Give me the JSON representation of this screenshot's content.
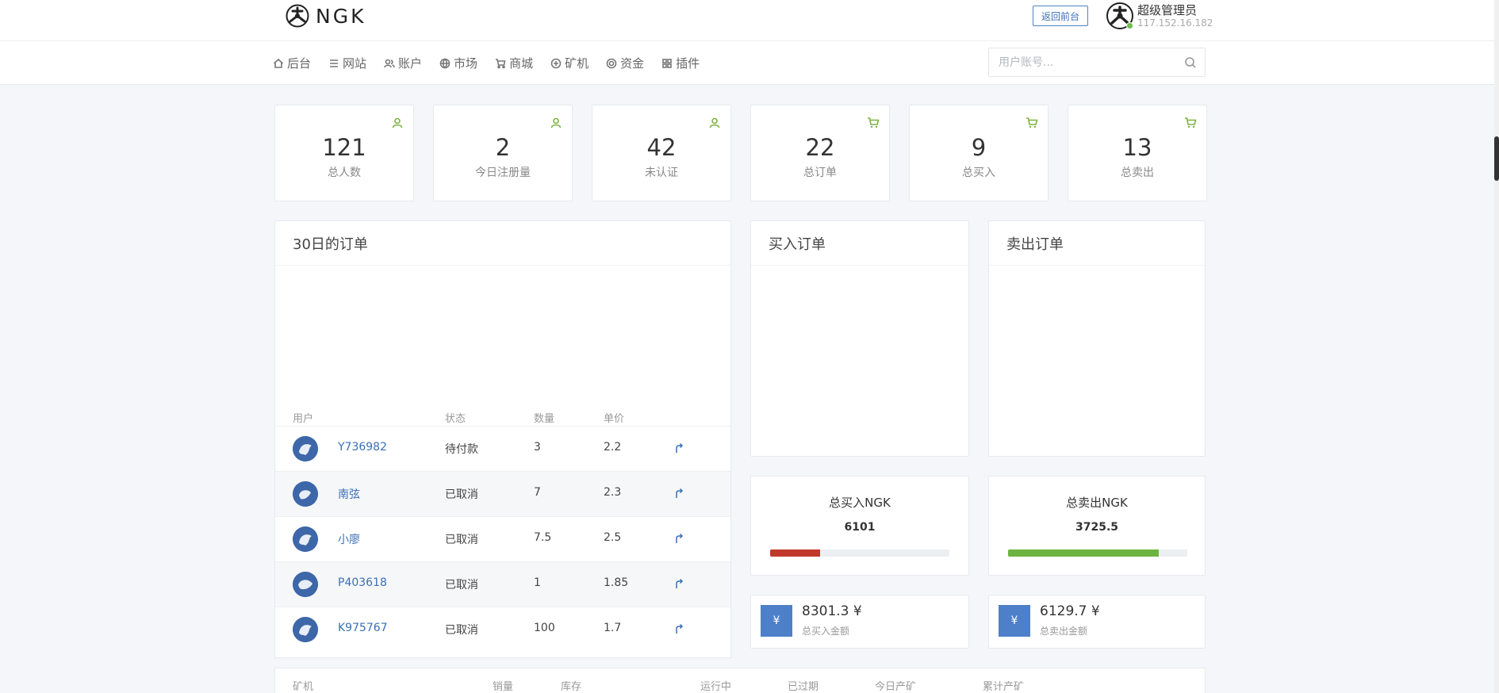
{
  "header": {
    "logo_text": "NGK",
    "front_button": "返回前台",
    "admin_name": "超级管理员",
    "admin_ip": "117.152.16.182"
  },
  "nav": {
    "items": [
      {
        "label": "后台",
        "icon": "home-icon"
      },
      {
        "label": "网站",
        "icon": "list-icon"
      },
      {
        "label": "账户",
        "icon": "users-icon"
      },
      {
        "label": "市场",
        "icon": "globe-icon"
      },
      {
        "label": "商城",
        "icon": "cart-icon"
      },
      {
        "label": "矿机",
        "icon": "mining-icon"
      },
      {
        "label": "资金",
        "icon": "fund-icon"
      },
      {
        "label": "插件",
        "icon": "grid-icon"
      }
    ],
    "search_placeholder": "用户账号..."
  },
  "stats": [
    {
      "value": "121",
      "label": "总人数",
      "icon": "user-icon"
    },
    {
      "value": "2",
      "label": "今日注册量",
      "icon": "user-icon"
    },
    {
      "value": "42",
      "label": "未认证",
      "icon": "user-icon"
    },
    {
      "value": "22",
      "label": "总订单",
      "icon": "cart-icon"
    },
    {
      "value": "9",
      "label": "总买入",
      "icon": "cart-icon"
    },
    {
      "value": "13",
      "label": "总卖出",
      "icon": "cart-icon"
    }
  ],
  "orders_panel": {
    "title": "30日的订单",
    "columns": [
      "用户",
      "状态",
      "数量",
      "单价"
    ],
    "rows": [
      {
        "user": "Y736982",
        "status": "待付款",
        "qty": "3",
        "price": "2.2"
      },
      {
        "user": "南弦",
        "status": "已取消",
        "qty": "7",
        "price": "2.3"
      },
      {
        "user": "小廖",
        "status": "已取消",
        "qty": "7.5",
        "price": "2.5"
      },
      {
        "user": "P403618",
        "status": "已取消",
        "qty": "1",
        "price": "1.85"
      },
      {
        "user": "K975767",
        "status": "已取消",
        "qty": "100",
        "price": "1.7"
      }
    ]
  },
  "buy_panel": {
    "title": "买入订单"
  },
  "sell_panel": {
    "title": "卖出订单"
  },
  "totals": {
    "buy": {
      "title": "总买入NGK",
      "value": "6101",
      "progress": 0.28,
      "color": "#c0392b"
    },
    "sell": {
      "title": "总卖出NGK",
      "value": "3725.5",
      "progress": 0.84,
      "color": "#6db33f"
    }
  },
  "money": {
    "buy": {
      "value": "8301.3 ¥",
      "label": "总买入金额",
      "icon_text": "¥"
    },
    "sell": {
      "value": "6129.7 ¥",
      "label": "总卖出金额",
      "icon_text": "¥"
    }
  },
  "bottom_table": {
    "columns": [
      "矿机",
      "销量",
      "库存",
      "运行中",
      "已过期",
      "今日产矿",
      "累计产矿"
    ]
  },
  "colors": {
    "accent": "#3a6fb5",
    "online": "#6abf4b",
    "icon_green": "#7cb342"
  }
}
